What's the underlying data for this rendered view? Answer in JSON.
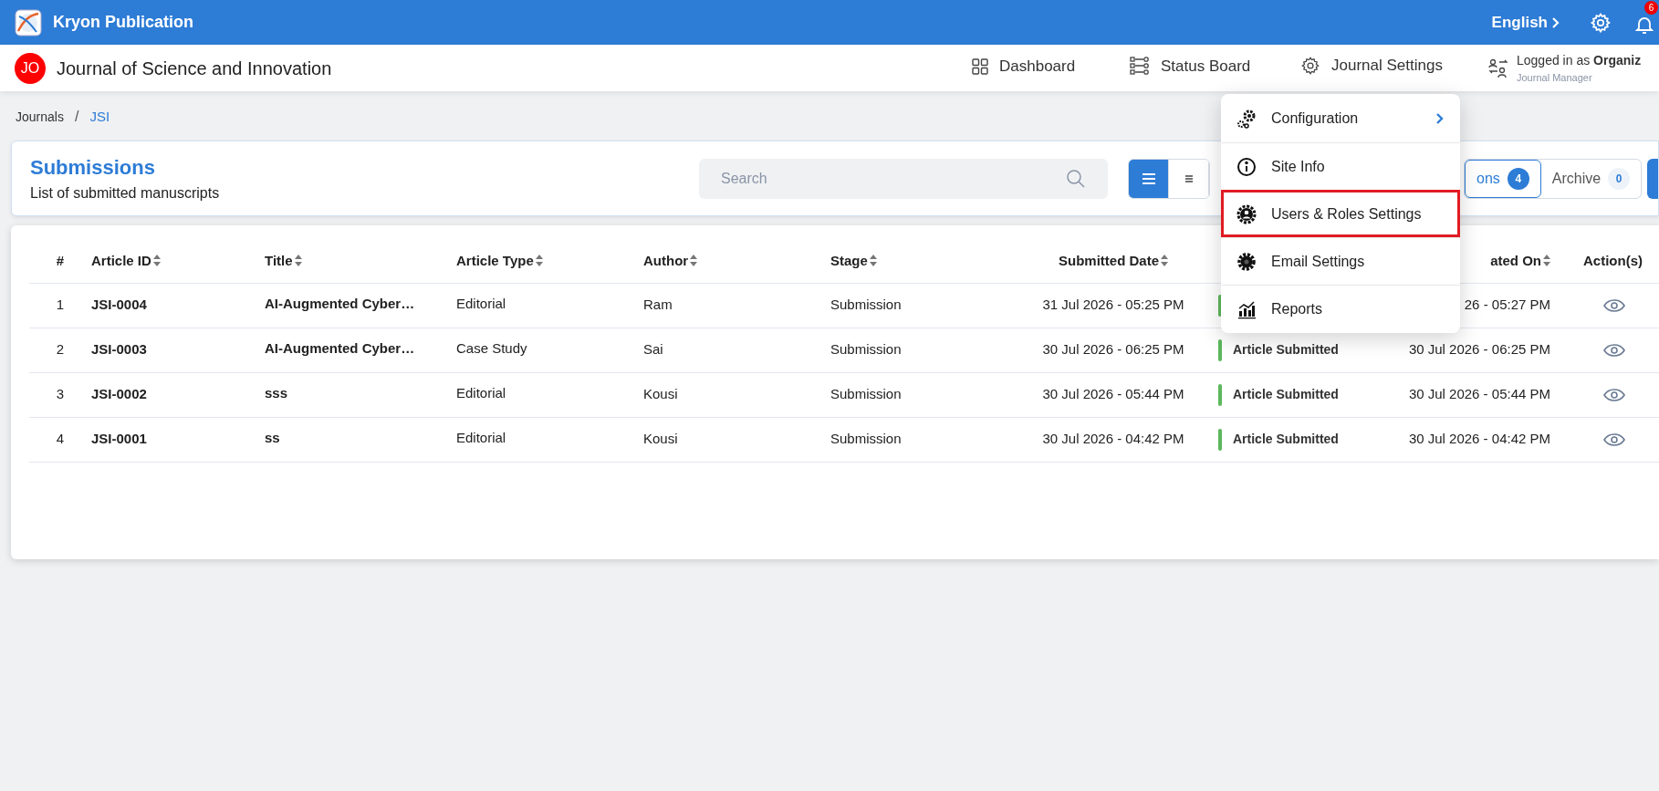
{
  "app_bar": {
    "title": "Kryon Publication",
    "language": "English",
    "notification_count": "6"
  },
  "journal_header": {
    "avatar": "JO",
    "title": "Journal of Science and Innovation",
    "nav": [
      {
        "label": "Dashboard"
      },
      {
        "label": "Status Board"
      },
      {
        "label": "Journal Settings"
      }
    ],
    "user": {
      "line": "Logged in as **Organiz**",
      "role": "Journal Manager"
    }
  },
  "breadcrumb": {
    "separator": "/",
    "items": [
      {
        "label": "Journals",
        "current": false
      },
      {
        "label": "JSI",
        "current": true
      }
    ]
  },
  "submissions": {
    "title": "Submissions",
    "subtitle": "List of submitted manuscripts",
    "search": {
      "placeholder": "Search"
    },
    "view_buttons": [
      {
        "selected": true
      },
      {
        "selected": false
      }
    ],
    "tabs": [
      {
        "label": "ons",
        "count": "4",
        "selected": true
      },
      {
        "label": "Archive",
        "count": "0",
        "selected": false
      }
    ]
  },
  "table": {
    "columns": [
      {
        "label": "#",
        "sortable": false
      },
      {
        "label": "Article ID",
        "sortable": true
      },
      {
        "label": "Title",
        "sortable": true
      },
      {
        "label": "Article Type",
        "sortable": true
      },
      {
        "label": "Author",
        "sortable": true
      },
      {
        "label": "Stage",
        "sortable": true
      },
      {
        "label": "Submitted Date",
        "sortable": true
      },
      {
        "label": "ated On",
        "sortable": true
      },
      {
        "label": "Action(s)",
        "sortable": false
      }
    ],
    "rows": [
      {
        "number": "1",
        "article_id": "JSI-0004",
        "title": "AI-Augmented Cyber…",
        "article_type": "Editorial",
        "author": "Ram",
        "stage": "Submission",
        "submitted_date": "31 Jul 2026 - 05:25 PM",
        "updated_on": "26 - 05:27 PM"
      },
      {
        "number": "2",
        "article_id": "JSI-0003",
        "title": "AI-Augmented Cyber…",
        "article_type": "Case Study",
        "author": "Sai",
        "stage": "Submission",
        "submitted_date": "30 Jul 2026 - 06:25 PM",
        "status": "Article Submitted",
        "updated_on": "30 Jul 2026 - 06:25 PM"
      },
      {
        "number": "3",
        "article_id": "JSI-0002",
        "title": "sss",
        "article_type": "Editorial",
        "author": "Kousi",
        "stage": "Submission",
        "submitted_date": "30 Jul 2026 - 05:44 PM",
        "status": "Article Submitted",
        "updated_on": "30 Jul 2026 - 05:44 PM"
      },
      {
        "number": "4",
        "article_id": "JSI-0001",
        "title": "ss",
        "article_type": "Editorial",
        "author": "Kousi",
        "stage": "Submission",
        "submitted_date": "30 Jul 2026 - 04:42 PM",
        "status": "Article Submitted",
        "updated_on": "30 Jul 2026 - 04:42 PM"
      }
    ]
  },
  "settings_menu": {
    "items": [
      {
        "label": "Configuration",
        "submenu": true,
        "highlighted": false
      },
      {
        "label": "Site Info",
        "submenu": false,
        "highlighted": false
      },
      {
        "label": "Users & Roles Settings",
        "submenu": false,
        "highlighted": true
      },
      {
        "label": "Email Settings",
        "submenu": false,
        "highlighted": false
      },
      {
        "label": "Reports",
        "submenu": false,
        "highlighted": false
      }
    ]
  }
}
